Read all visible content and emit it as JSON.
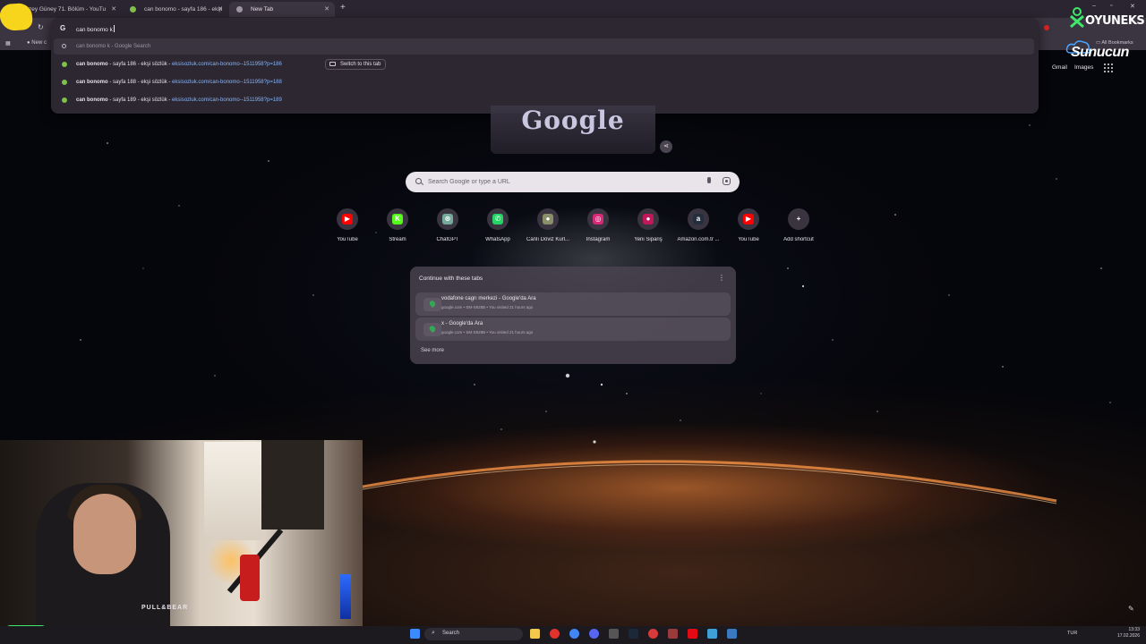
{
  "tabs": [
    {
      "label": "Kuzey Güney 71. Bölüm - YouTu",
      "active": false
    },
    {
      "label": "can bonomo - sayfa 186 - ekşi",
      "active": false
    },
    {
      "label": "New Tab",
      "active": true
    }
  ],
  "omnibox": {
    "query": "can bonomo k",
    "suggestions": [
      {
        "bold": "can bonomo k",
        "rest": " - Google Search",
        "url": "",
        "icon": "search-icon"
      },
      {
        "bold": "can bonomo",
        "rest": " - sayfa 186 - ekşi sözlük - ",
        "url": "eksisozluk.com/can-bonomo--1511958?p=186",
        "icon": "eksi-favicon",
        "action": "Switch to this tab"
      },
      {
        "bold": "can bonomo",
        "rest": " - sayfa 188 - ekşi sözlük - ",
        "url": "eksisozluk.com/can-bonomo--1511958?p=188",
        "icon": "eksi-favicon"
      },
      {
        "bold": "can bonomo",
        "rest": " - sayfa 189 - ekşi sözlük - ",
        "url": "eksisozluk.com/can-bonomo--1511958?p=189",
        "icon": "eksi-favicon"
      }
    ]
  },
  "bookmarks_bar": {
    "all_bookmarks": "All Bookmarks",
    "first_item": "New c"
  },
  "header_links": {
    "gmail": "Gmail",
    "images": "Images"
  },
  "doodle_text": "Google",
  "search": {
    "placeholder": "Search Google or type a URL"
  },
  "shortcuts": [
    {
      "label": "YouTube",
      "icon": "youtube-icon",
      "color": "#ff0000",
      "glyph": "▶"
    },
    {
      "label": "Stream",
      "icon": "kick-icon",
      "color": "#53fc18",
      "glyph": "K"
    },
    {
      "label": "ChatGPT",
      "icon": "chatgpt-icon",
      "color": "#74aa9c",
      "glyph": "⊛"
    },
    {
      "label": "WhatsApp",
      "icon": "whatsapp-icon",
      "color": "#25d366",
      "glyph": "✆"
    },
    {
      "label": "Canlı Döviz Kurl...",
      "icon": "currency-icon",
      "color": "#8a8f6a",
      "glyph": "●"
    },
    {
      "label": "Instagram",
      "icon": "instagram-icon",
      "color": "#d62976",
      "glyph": "◎"
    },
    {
      "label": "Yeni Sipariş",
      "icon": "order-icon",
      "color": "#c2185b",
      "glyph": "●"
    },
    {
      "label": "Amazon.com.tr ...",
      "icon": "amazon-icon",
      "color": "#232f3e",
      "glyph": "a"
    },
    {
      "label": "YouTube",
      "icon": "youtube-icon",
      "color": "#ff0000",
      "glyph": "▶"
    },
    {
      "label": "Add shortcut",
      "icon": "plus-icon",
      "color": "#3a3440",
      "glyph": "+"
    }
  ],
  "continue_tabs": {
    "title": "Continue with these tabs",
    "items": [
      {
        "title": "vodafone cagrı merkezi - Google'da Ara",
        "sub": "google.com • SM-S928B • You visited 21 hours ago"
      },
      {
        "title": "x - Google'da Ara",
        "sub": "google.com • SM-S928B • You visited 21 hours ago"
      }
    ],
    "see_more": "See more"
  },
  "webcam": {
    "shirt_text": "PULL&BEAR"
  },
  "watermarks": {
    "oyuneks": "OYUNEKS",
    "sunucun": "Sunucun"
  },
  "taskbar": {
    "search_label": "Search",
    "lang": "TUR",
    "time": "13:33",
    "date": "17.02.2026"
  }
}
